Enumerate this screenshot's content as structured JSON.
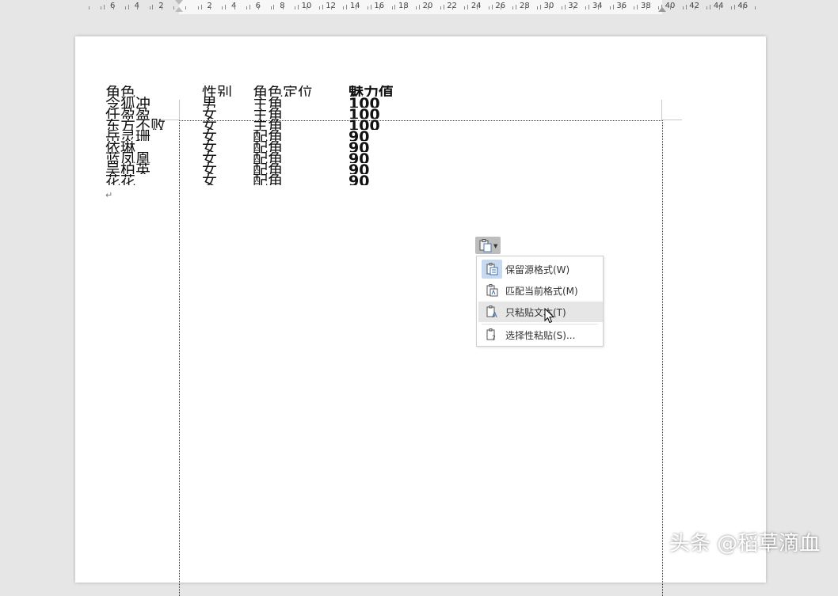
{
  "ruler": {
    "numbers": [
      "6",
      "4",
      "2",
      "2",
      "4",
      "6",
      "8",
      "10",
      "12",
      "14",
      "16",
      "18",
      "20",
      "22",
      "24",
      "26",
      "28",
      "30",
      "32",
      "34",
      "36",
      "38",
      "40",
      "42",
      "44",
      "46"
    ]
  },
  "table": {
    "rows": [
      [
        "角色",
        "性别",
        "角色定位",
        "魅力值"
      ],
      [
        "令狐冲",
        "男",
        "主角",
        "100"
      ],
      [
        "任盈盈",
        "女",
        "主角",
        "100"
      ],
      [
        "东方不败",
        "女",
        "主角",
        "100"
      ],
      [
        "岳灵珊",
        "女",
        "配角",
        "90"
      ],
      [
        "依琳",
        "女",
        "配角",
        "90"
      ],
      [
        "蓝凤凰",
        "女",
        "配角",
        "90"
      ],
      [
        "吴柏英",
        "女",
        "配角",
        "90"
      ],
      [
        "花花",
        "女",
        "配角",
        "90"
      ]
    ]
  },
  "paragraph_mark": "↵",
  "paste_menu": {
    "items": [
      {
        "label": "保留源格式(W)",
        "icon": "keep-source-format-icon"
      },
      {
        "label": "匹配当前格式(M)",
        "icon": "match-format-icon"
      },
      {
        "label": "只粘贴文本(T)",
        "icon": "paste-text-only-icon"
      },
      {
        "label": "选择性粘贴(S)...",
        "icon": "paste-special-icon"
      }
    ]
  },
  "watermark": "头条 @稻草滴血",
  "colors": {
    "menu_highlight": "#e6e6e6",
    "selected_icon_bg": "#c6d9f0",
    "paste_button_bg": "#bdbdbd"
  }
}
